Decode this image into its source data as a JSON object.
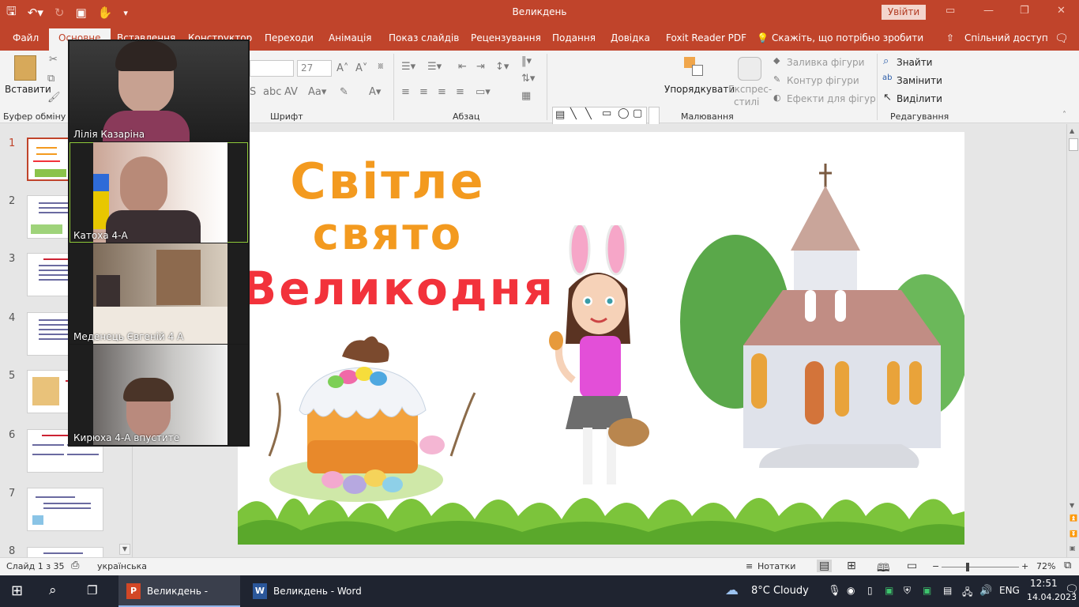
{
  "window": {
    "title": "Великдень",
    "signin_label": "Увійти",
    "qat_icons": [
      "save-icon",
      "undo-icon",
      "redo-icon",
      "start-from-beginning-icon",
      "touch-mode-icon",
      "customize-icon"
    ]
  },
  "tabs": [
    "Файл",
    "Основне",
    "Вставлення",
    "Конструктор",
    "Переходи",
    "Анімація",
    "Показ слайдів",
    "Рецензування",
    "Подання",
    "Довідка",
    "Foxit Reader PDF"
  ],
  "tell_me": "Скажіть, що потрібно зробити",
  "share_label": "Спільний доступ",
  "ribbon": {
    "clipboard": {
      "paste_label": "Вставити",
      "group_label": "Буфер обміну"
    },
    "font": {
      "font_size": "27",
      "group_label": "Шрифт"
    },
    "paragraph": {
      "group_label": "Абзац"
    },
    "drawing": {
      "arrange_label": "Упорядкувати",
      "quick_styles_label_1": "Експрес-",
      "quick_styles_label_2": "стилі",
      "shape_fill_label": "Заливка фігури",
      "shape_outline_label": "Контур фігури",
      "shape_effects_label": "Ефекти для фігур",
      "group_label": "Малювання"
    },
    "editing": {
      "find_label": "Знайти",
      "replace_label": "Замінити",
      "select_label": "Виділити",
      "group_label": "Редагування"
    }
  },
  "thumbnails": [
    {
      "num": "1",
      "selected": true
    },
    {
      "num": "2"
    },
    {
      "num": "3"
    },
    {
      "num": "4"
    },
    {
      "num": "5"
    },
    {
      "num": "6"
    },
    {
      "num": "7"
    },
    {
      "num": "8"
    }
  ],
  "slide": {
    "title_line1": "Світле",
    "title_line2": "свято",
    "title_line3": "Великодня",
    "colors": {
      "line1": "#f39a1f",
      "line2": "#f39a1f",
      "line3": "#f2323b"
    }
  },
  "zoom_participants": [
    {
      "name": "Лілія Казаріна"
    },
    {
      "name": "Катоха 4-А",
      "active_speaker": true
    },
    {
      "name": "Меденець Євгеній 4 А"
    },
    {
      "name": "Кирюха 4-А впустите"
    }
  ],
  "status": {
    "slide_info": "Слайд 1 з 35",
    "language": "українська",
    "notes_label": "Нотатки",
    "zoom_level": "72%"
  },
  "taskbar": {
    "apps": [
      {
        "label": "Великдень - Power...",
        "icon": "powerpoint-icon",
        "active": true
      },
      {
        "label": "Великдень - Word",
        "icon": "word-icon"
      }
    ],
    "weather": "8°C  Cloudy",
    "keyboard_lang": "ENG",
    "time": "12:51",
    "date": "14.04.2023"
  }
}
